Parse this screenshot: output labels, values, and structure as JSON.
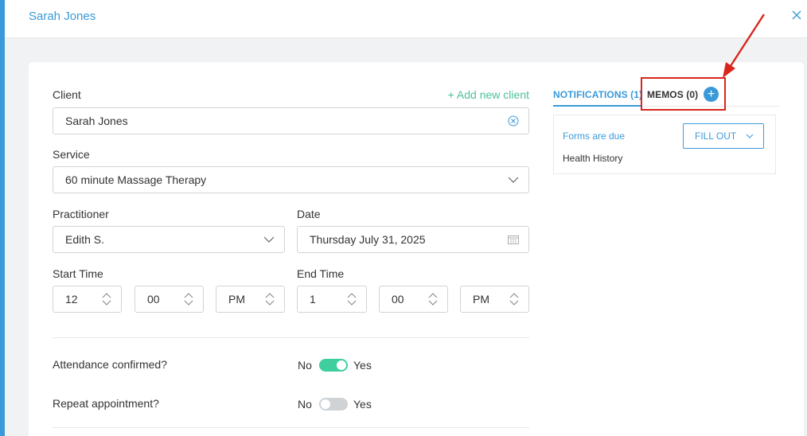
{
  "header": {
    "title": "Sarah Jones"
  },
  "form": {
    "client_label": "Client",
    "add_client_link": "+ Add new client",
    "client_value": "Sarah Jones",
    "service_label": "Service",
    "service_value": "60 minute Massage Therapy",
    "practitioner_label": "Practitioner",
    "practitioner_value": "Edith S.",
    "date_label": "Date",
    "date_value": "Thursday July 31, 2025",
    "start_time_label": "Start Time",
    "start_hour": "12",
    "start_minute": "00",
    "start_ampm": "PM",
    "end_time_label": "End Time",
    "end_hour": "1",
    "end_minute": "00",
    "end_ampm": "PM",
    "attendance_label": "Attendance confirmed?",
    "attendance_no": "No",
    "attendance_yes": "Yes",
    "attendance_on": true,
    "repeat_label": "Repeat appointment?",
    "repeat_no": "No",
    "repeat_yes": "Yes",
    "repeat_on": false
  },
  "side": {
    "tab_notifications": "NOTIFICATIONS (1)",
    "tab_memos": "MEMOS (0)",
    "add_memo_symbol": "+",
    "notification_title": "Forms are due",
    "notification_item": "Health History",
    "fill_out_label": "FILL OUT"
  },
  "colors": {
    "accent": "#3a9ad9",
    "toggle_on": "#3fcf9f",
    "toggle_off": "#cfd3d6",
    "annotation": "#d9261c"
  },
  "icons": [
    "close-icon",
    "clear-icon",
    "chevron-down-icon",
    "calendar-icon",
    "spinner-icon",
    "plus-icon",
    "arrow-annotation"
  ]
}
